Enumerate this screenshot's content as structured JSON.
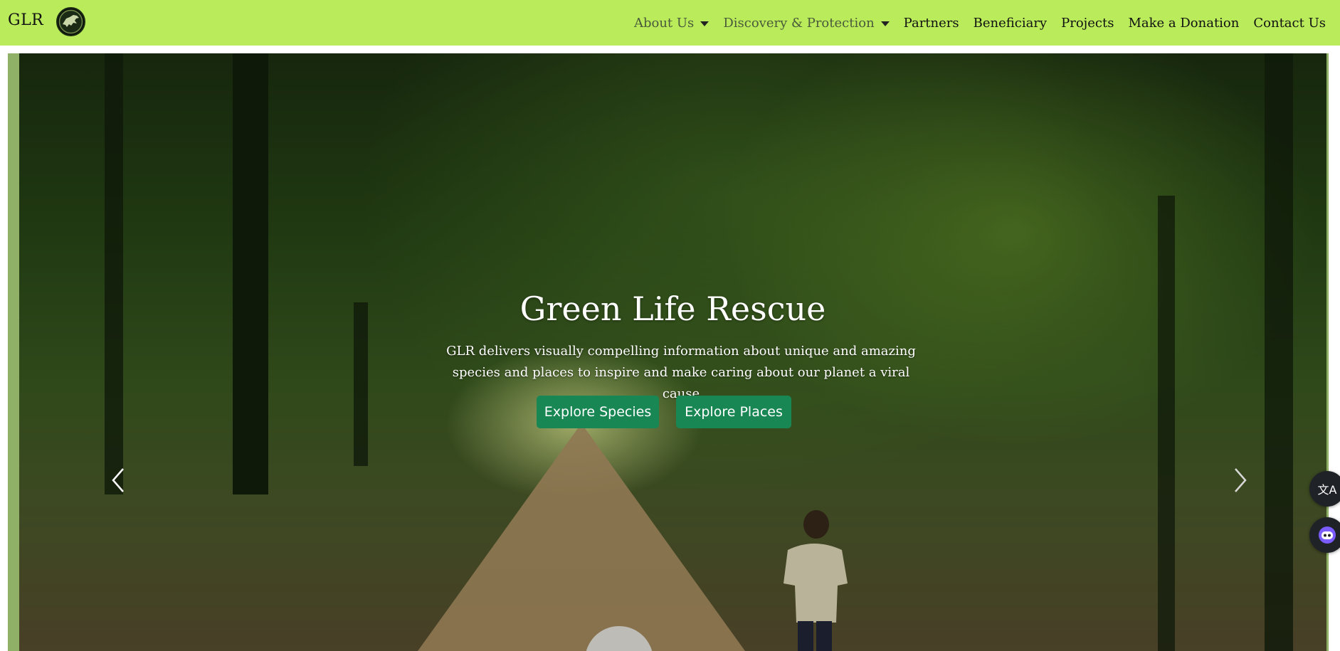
{
  "brand": {
    "name": "GLR",
    "logo_icon": "dinosaur-logo-icon"
  },
  "nav": {
    "items": [
      {
        "label": "About Us",
        "dropdown": true
      },
      {
        "label": "Discovery & Protection",
        "dropdown": true
      },
      {
        "label": "Partners",
        "dropdown": false
      },
      {
        "label": "Beneficiary",
        "dropdown": false
      },
      {
        "label": "Projects",
        "dropdown": false
      },
      {
        "label": "Make a Donation",
        "dropdown": false
      },
      {
        "label": "Contact Us",
        "dropdown": false
      }
    ]
  },
  "hero": {
    "title": "Green Life Rescue",
    "subtitle": "GLR delivers visually compelling information about unique and amazing species and places to inspire and make caring about our planet a viral cause",
    "buttons": {
      "species": "Explore Species",
      "places": "Explore Places"
    },
    "prev_icon": "chevron-left-icon",
    "next_icon": "chevron-right-icon"
  },
  "floating": {
    "translate_icon": "translate-icon",
    "translate_glyph": "文A",
    "assistant_icon": "assistant-bot-icon"
  },
  "colors": {
    "navbar_bg": "#b9eb5b",
    "button_bg": "#198754",
    "hero_text": "#ffffff"
  }
}
